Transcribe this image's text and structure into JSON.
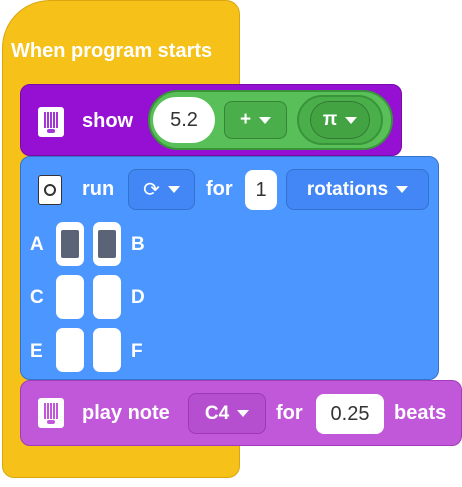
{
  "hat": {
    "title": "When program starts"
  },
  "show_block": {
    "label": "show",
    "left_value": "5.2",
    "operator": "+",
    "constant": "π"
  },
  "motor_block": {
    "label": "run",
    "direction_icon": "clockwise-arrow",
    "for_label": "for",
    "amount": "1",
    "unit": "rotations",
    "ports": [
      {
        "label": "A",
        "filled": true
      },
      {
        "label": "B",
        "filled": true
      },
      {
        "label": "C",
        "filled": false
      },
      {
        "label": "D",
        "filled": false
      },
      {
        "label": "E",
        "filled": false
      },
      {
        "label": "F",
        "filled": false
      }
    ]
  },
  "music_block": {
    "label": "play note",
    "note": "C4",
    "for_label": "for",
    "beats": "0.25",
    "beats_label": "beats"
  },
  "colors": {
    "events": "#f6c118",
    "display": "#9510d2",
    "operators": "#59c059",
    "motors": "#4c97ff",
    "music": "#c058d9"
  }
}
